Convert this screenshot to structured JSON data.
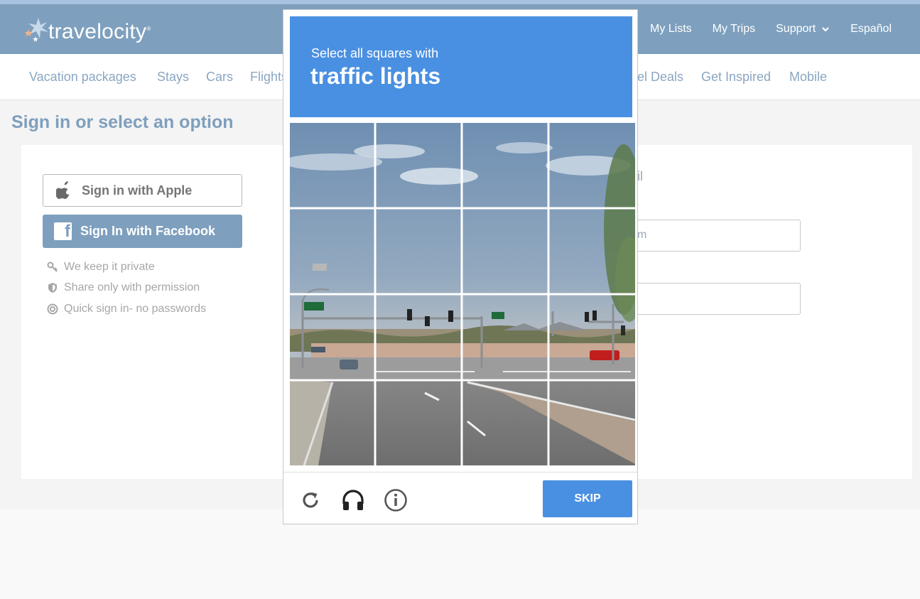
{
  "header": {
    "brand": "travelocity",
    "brand_mark": "®",
    "nav": [
      {
        "label": "My Lists"
      },
      {
        "label": "My Trips"
      },
      {
        "label": "Support"
      },
      {
        "label": "Español"
      }
    ]
  },
  "subnav": {
    "items": [
      "Vacation packages",
      "Stays",
      "Cars",
      "Flights",
      "el Deals",
      "Get Inspired",
      "Mobile"
    ]
  },
  "signin": {
    "title": "Sign in or select an option",
    "apple_label": "Sign in with Apple",
    "facebook_label": "Sign In with Facebook",
    "perks": [
      "We keep it private",
      "Share only with permission",
      "Quick sign in- no passwords"
    ],
    "email_label_fragment": "il",
    "email_placeholder_fragment": "m"
  },
  "captcha": {
    "instruction": "Select all squares with",
    "target": "traffic lights",
    "skip_label": "SKIP",
    "grid_rows": 4,
    "grid_cols": 4,
    "icons": [
      "reload-icon",
      "headphones-icon",
      "info-icon"
    ]
  },
  "colors": {
    "header": "#7ea0be",
    "captcha_blue": "#4a90e2",
    "link": "#8aa6c2"
  }
}
